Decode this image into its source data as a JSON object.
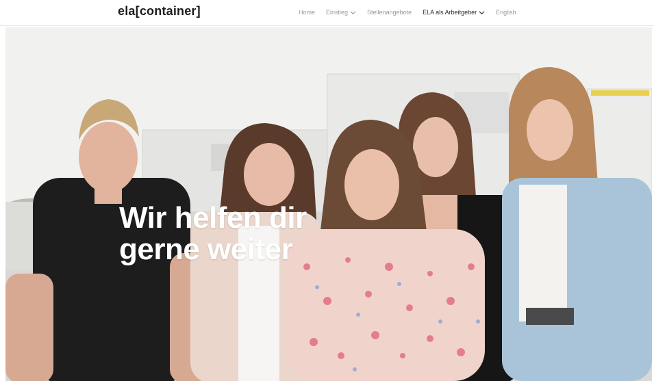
{
  "brand": {
    "logo_text": "ela[container]"
  },
  "nav": {
    "items": [
      {
        "label": "Home",
        "has_dropdown": false
      },
      {
        "label": "Einstieg",
        "has_dropdown": true
      },
      {
        "label": "Stellenangebote",
        "has_dropdown": false
      },
      {
        "label": "ELA als Arbeitgeber",
        "has_dropdown": true,
        "active": true
      },
      {
        "label": "English",
        "has_dropdown": false
      }
    ]
  },
  "hero": {
    "headline_line1": "Wir helfen dir",
    "headline_line2": "gerne weiter",
    "image_description_icons": [
      "team-photo"
    ]
  },
  "colors": {
    "nav_text": "#9a9a9a",
    "nav_active": "#2a2a2a",
    "logo": "#1c1c1c",
    "headline": "#ffffff"
  }
}
